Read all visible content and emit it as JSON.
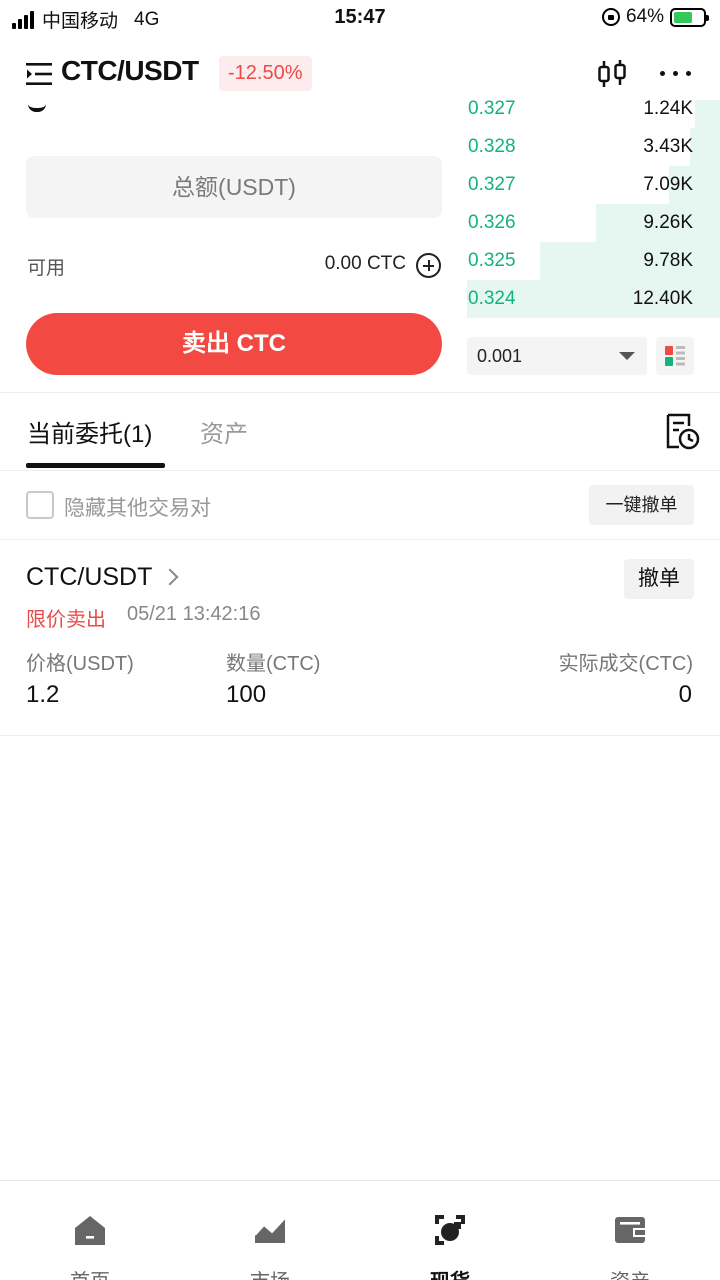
{
  "status_bar": {
    "carrier": "中国移动",
    "network": "4G",
    "time": "15:47",
    "battery": "64%"
  },
  "header": {
    "pair": "CTC/USDT",
    "change": "-12.50%"
  },
  "form": {
    "total_placeholder": "总额(USDT)",
    "available_label": "可用",
    "available_value": "0.00 CTC",
    "sell_label": "卖出 CTC"
  },
  "order_book": {
    "rows": [
      {
        "price": "0.327",
        "qty": "1.24K",
        "depth": 0.1
      },
      {
        "price": "0.328",
        "qty": "3.43K",
        "depth": 0.12
      },
      {
        "price": "0.327",
        "qty": "7.09K",
        "depth": 0.2
      },
      {
        "price": "0.326",
        "qty": "9.26K",
        "depth": 0.49
      },
      {
        "price": "0.325",
        "qty": "9.78K",
        "depth": 0.71
      },
      {
        "price": "0.324",
        "qty": "12.40K",
        "depth": 1.0
      }
    ],
    "precision": "0.001"
  },
  "tabs": {
    "open_orders": "当前委托(1)",
    "assets": "资产"
  },
  "filter": {
    "hide_label": "隐藏其他交易对",
    "cancel_all": "一键撤单"
  },
  "order": {
    "pair": "CTC/USDT",
    "cancel": "撤单",
    "type": "限价卖出",
    "time": "05/21 13:42:16",
    "price_label": "价格(USDT)",
    "price": "1.2",
    "amount_label": "数量(CTC)",
    "amount": "100",
    "filled_label": "实际成交(CTC)",
    "filled": "0"
  },
  "nav": {
    "home": "首页",
    "market": "市场",
    "spot": "现货",
    "assets": "资产"
  },
  "colors": {
    "sell": "#f24a43",
    "buy": "#14b27c",
    "down_text": "#e94c48"
  }
}
